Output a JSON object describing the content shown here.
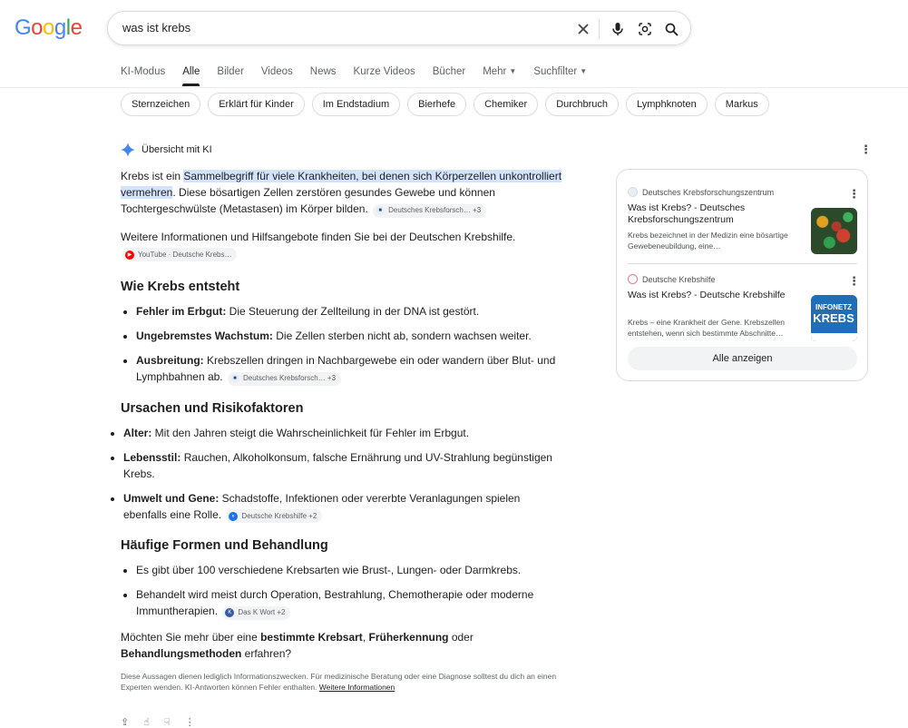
{
  "logo": "Google",
  "search": {
    "query": "was ist krebs"
  },
  "tabs": [
    {
      "label": "KI-Modus"
    },
    {
      "label": "Alle"
    },
    {
      "label": "Bilder"
    },
    {
      "label": "Videos"
    },
    {
      "label": "News"
    },
    {
      "label": "Kurze Videos"
    },
    {
      "label": "Bücher"
    },
    {
      "label": "Mehr"
    },
    {
      "label": "Suchfilter"
    }
  ],
  "chips": [
    "Sternzeichen",
    "Erklärt für Kinder",
    "Im Endstadium",
    "Bierhefe",
    "Chemiker",
    "Durchbruch",
    "Lymphknoten",
    "Markus"
  ],
  "ai": {
    "heading": "Übersicht mit KI",
    "intro_pre": "Krebs ist ein ",
    "intro_hl": "Sammelbegriff für viele Krankheiten, bei denen sich Körperzellen unkontrolliert vermehren",
    "intro_post": ". Diese bösartigen Zellen zerstören gesundes Gewebe und können Tochtergeschwülste (Metastasen) im Körper bilden.",
    "intro_cite": "Deutsches Krebsforsch…  +3",
    "info": "Weitere Informationen und Hilfsangebote finden Sie bei der Deutschen Krebshilfe.",
    "info_cite": "YouTube · Deutsche Krebs…",
    "s1_title": "Wie Krebs entsteht",
    "s1_items": [
      {
        "bold": "Fehler im Erbgut:",
        "text": " Die Steuerung der Zellteilung in der DNA ist gestört."
      },
      {
        "bold": "Ungebremstes Wachstum:",
        "text": " Die Zellen sterben nicht ab, sondern wachsen weiter."
      },
      {
        "bold": "Ausbreitung:",
        "text": " Krebszellen dringen in Nachbargewebe ein oder wandern über Blut- und Lymphbahnen ab."
      }
    ],
    "s1_cite": "Deutsches Krebsforsch…  +3",
    "s2_title": "Ursachen und Risikofaktoren",
    "s2_items": [
      {
        "bold": "Alter:",
        "text": " Mit den Jahren steigt die Wahrscheinlichkeit für Fehler im Erbgut."
      },
      {
        "bold": "Lebensstil:",
        "text": " Rauchen, Alkoholkonsum, falsche Ernährung und UV-Strahlung begünstigen Krebs."
      },
      {
        "bold": "Umwelt und Gene:",
        "text": " Schadstoffe, Infektionen oder vererbte Veranlagungen spielen ebenfalls eine Rolle."
      }
    ],
    "s2_cite": "Deutsche Krebshilfe +2",
    "s3_title": "Häufige Formen und Behandlung",
    "s3_items": [
      "Es gibt über 100 verschiedene Krebsarten wie Brust-, Lungen- oder Darmkrebs.",
      "Behandelt wird meist durch Operation, Bestrahlung, Chemotherapie oder moderne Immuntherapien."
    ],
    "s3_cite": "Das K Wort +2",
    "question_pre": "Möchten Sie mehr über eine ",
    "question_b1": "bestimmte Krebsart",
    "question_mid1": ", ",
    "question_b2": "Früherkennung",
    "question_mid2": " oder ",
    "question_b3": "Behandlungsmethoden",
    "question_post": " erfahren?",
    "disclaimer": "Diese Aussagen dienen lediglich Informationszwecken. Für medizinische Beratung oder eine Diagnose solltest du dich an einen Experten wenden. KI-Antworten können Fehler enthalten. ",
    "disclaimer_link": "Weitere Informationen"
  },
  "sources": [
    {
      "site": "Deutsches Krebsforschungszentrum",
      "title": "Was ist Krebs? - Deutsches Krebsforschungszentrum",
      "snippet": "Krebs bezeichnet in der Medizin eine bösartige Gewebeneubildung, eine…"
    },
    {
      "site": "Deutsche Krebshilfe",
      "title": "Was ist Krebs? - Deutsche Krebshilfe",
      "snippet": "Krebs – eine Krankheit der Gene. Krebszellen entstehen, wenn sich bestimmte Abschnitte…"
    }
  ],
  "show_all": "Alle anzeigen",
  "colors": {
    "blue": "#4285F4",
    "red": "#EA4335",
    "yellow": "#FBBC05",
    "green": "#34A853",
    "highlight": "#d3e3fd"
  }
}
